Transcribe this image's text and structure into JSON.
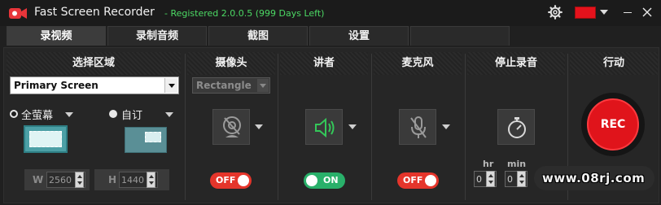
{
  "app": {
    "title": "Fast Screen Recorder",
    "registration": "- Registered 2.0.0.5 (999 Days Left)"
  },
  "colors": {
    "accent_green": "#4cd964",
    "record_red": "#e0141b",
    "toggle_on": "#29b06a",
    "toggle_off": "#e5352b"
  },
  "tabs": [
    {
      "label": "录视频",
      "active": true
    },
    {
      "label": "录制音频",
      "active": false
    },
    {
      "label": "截图",
      "active": false
    },
    {
      "label": "设置",
      "active": false
    }
  ],
  "sections": {
    "region": {
      "heading": "选择区域",
      "select_value": "Primary Screen",
      "option_full": "全萤幕",
      "option_custom": "自订",
      "width_label": "W",
      "width_value": "2560",
      "height_label": "H",
      "height_value": "1440"
    },
    "camera": {
      "heading": "摄像头",
      "shape_value": "Rectangle",
      "toggle_label": "OFF",
      "icon": "webcam-icon"
    },
    "speaker": {
      "heading": "讲者",
      "toggle_label": "ON",
      "icon": "speaker-icon"
    },
    "microphone": {
      "heading": "麦克风",
      "toggle_label": "OFF",
      "icon": "microphone-muted-icon"
    },
    "stop": {
      "heading": "停止录音",
      "hr_label": "hr",
      "min_label": "min",
      "hr_value": "0",
      "min_value": "0",
      "icon": "stopwatch-icon"
    },
    "action": {
      "heading": "行动",
      "rec_label": "REC"
    }
  },
  "watermark": {
    "text": "www.08rj.com"
  }
}
